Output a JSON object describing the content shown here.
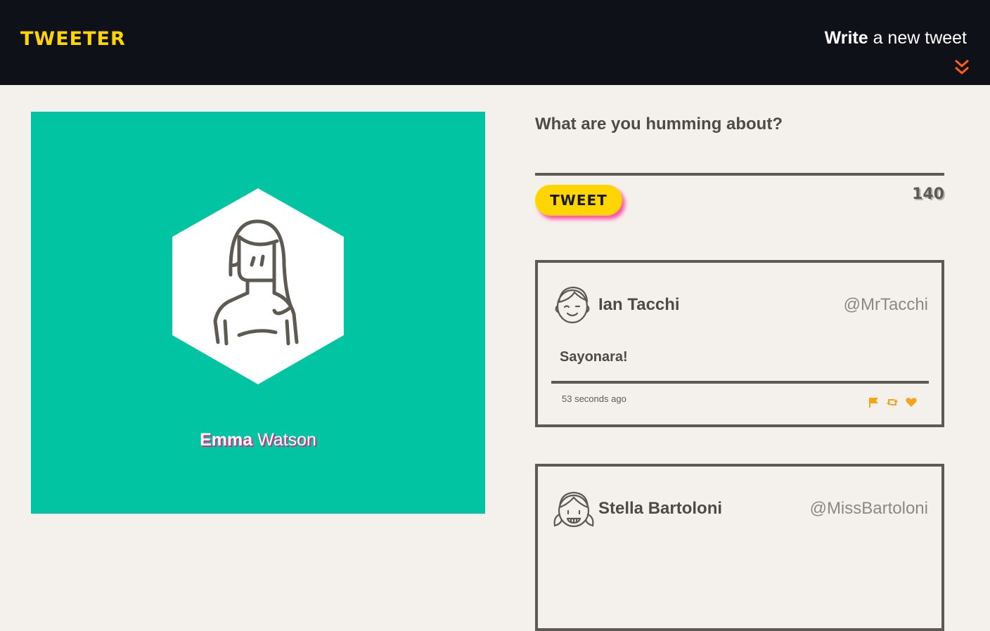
{
  "header": {
    "logo": "TWEETER",
    "compose_bold": "Write",
    "compose_rest": " a new tweet"
  },
  "profile": {
    "first_name": "Emma",
    "last_name": " Watson",
    "avatar_icon": "female-avatar-icon"
  },
  "composer": {
    "prompt": "What are you humming about?",
    "button_label": "TWEET",
    "counter": "140"
  },
  "tweets": [
    {
      "name": "Ian Tacchi",
      "handle": "@MrTacchi",
      "text": "Sayonara!",
      "time": "53 seconds ago",
      "avatar_icon": "winking-boy-avatar-icon"
    },
    {
      "name": "Stella Bartoloni",
      "handle": "@MissBartoloni",
      "avatar_icon": "girl-pigtails-avatar-icon"
    }
  ],
  "colors": {
    "nav_bg": "#0f1118",
    "brand_yellow": "#ffd500",
    "profile_bg": "#00c4a2",
    "accent_pink": "#e8208e",
    "accent_orange": "#ff5a1f",
    "action_orange": "#f7a21b",
    "page_bg": "#f4f1ec",
    "text_dark": "#4f4a44"
  },
  "icons": [
    "chevron-double-down-icon",
    "flag-icon",
    "retweet-icon",
    "heart-icon"
  ]
}
